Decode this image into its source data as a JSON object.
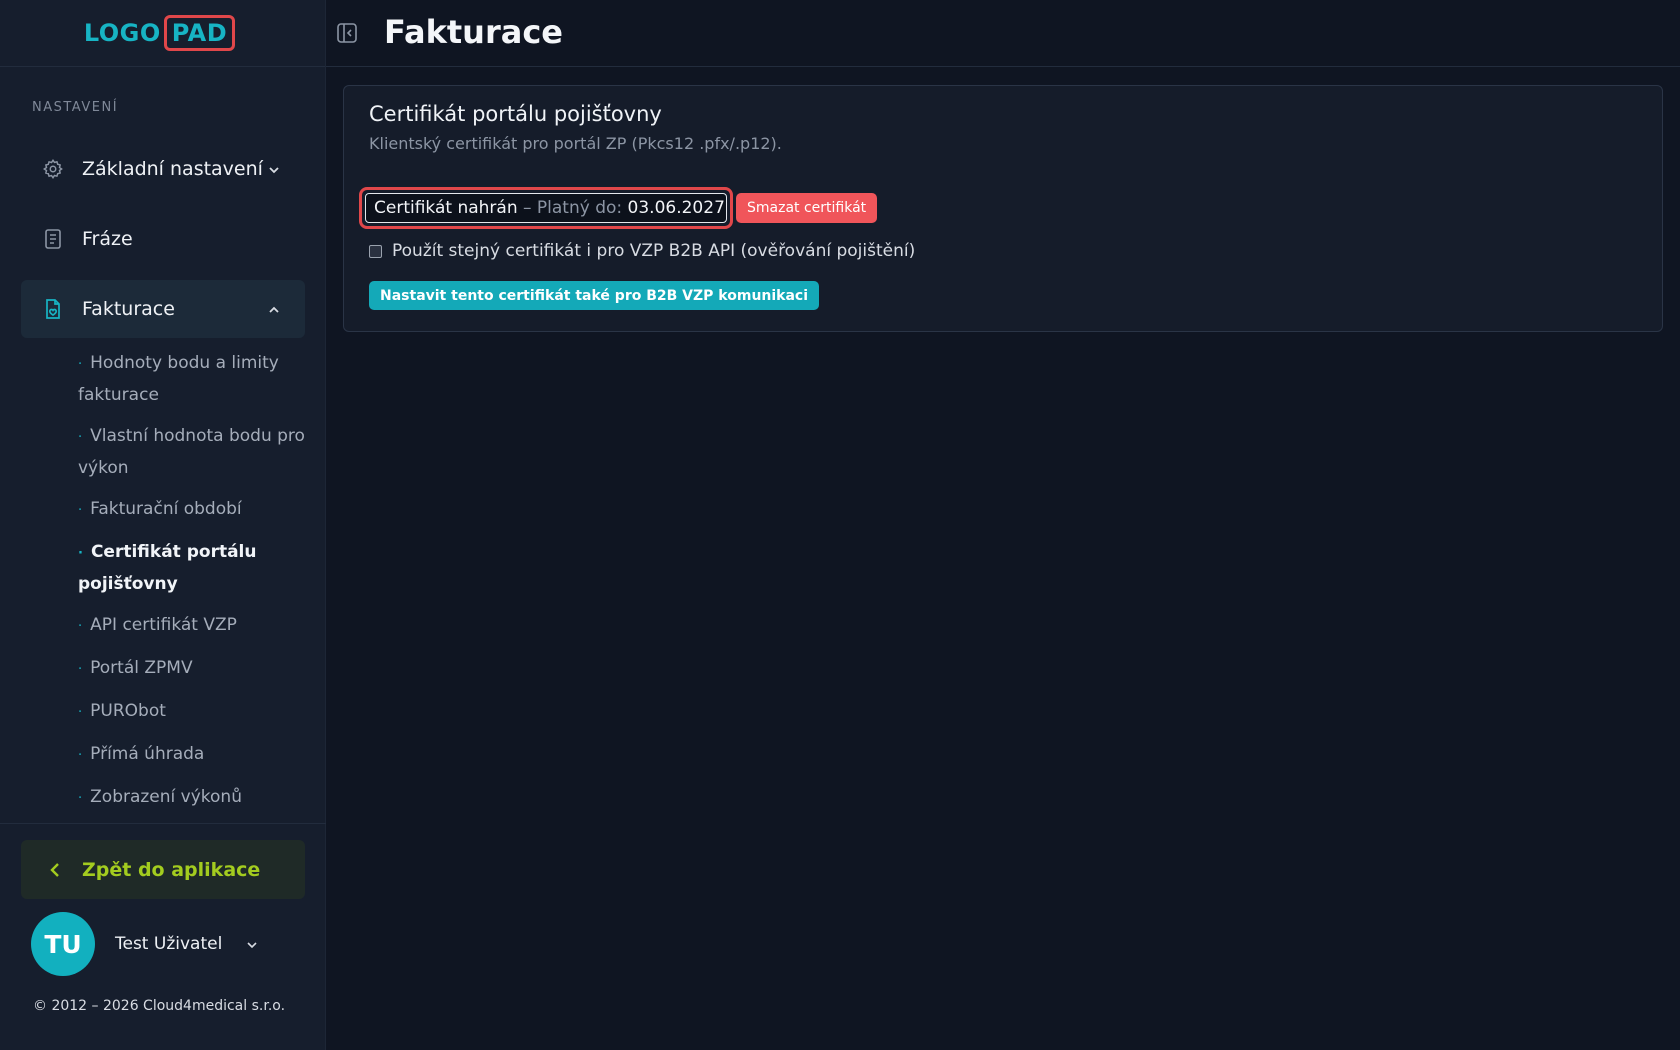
{
  "logo": {
    "part1": "LOGO",
    "part2": "PAD"
  },
  "sidebar": {
    "section_label": "NASTAVENÍ",
    "items": [
      {
        "label": "Základní nastavení",
        "icon": "gear-icon",
        "expanded": false
      },
      {
        "label": "Fráze",
        "icon": "document-icon"
      },
      {
        "label": "Fakturace",
        "icon": "invoice-icon",
        "expanded": true
      }
    ],
    "sub_items": [
      "Hodnoty bodu a limity fakturace",
      "Vlastní hodnota bodu pro výkon",
      "Fakturační období",
      "Certifikát portálu pojišťovny",
      "API certifikát VZP",
      "Portál ZPMV",
      "PURObot",
      "Přímá úhrada",
      "Zobrazení výkonů"
    ],
    "current_sub_item": "Certifikát portálu pojišťovny",
    "back_label": "Zpět do aplikace",
    "user": {
      "initials": "TU",
      "name": "Test Uživatel"
    },
    "copyright": "© 2012 – 2026 Cloud4medical s.r.o."
  },
  "header": {
    "title": "Fakturace"
  },
  "card": {
    "title": "Certifikát portálu pojišťovny",
    "subtitle": "Klientský certifikát pro portál ZP (Pkcs12 .pfx/.p12).",
    "status_uploaded": "Certifikát nahrán",
    "status_sep": " – Platný do: ",
    "status_date": "03.06.2027",
    "delete_label": "Smazat certifikát",
    "checkbox_label": "Použít stejný certifikát i pro VZP B2B API (ověřování pojištění)",
    "checkbox_checked": false,
    "b2b_button_label": "Nastavit tento certifikát také pro B2B VZP komunikaci"
  },
  "colors": {
    "accent": "#17b4c4",
    "danger": "#f0555a",
    "back_link": "#a3cc1f"
  }
}
